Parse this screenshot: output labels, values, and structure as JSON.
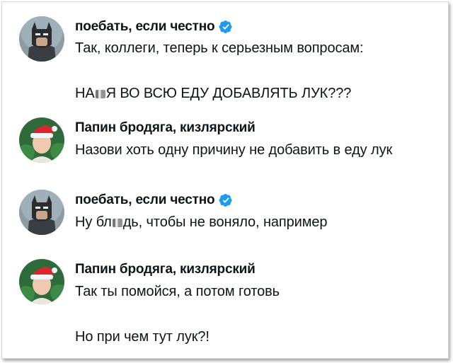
{
  "messages": [
    {
      "author": "поебать, если честно",
      "verified": true,
      "avatar": "batman-avatar",
      "lines": [
        "Так, коллеги, теперь к серьезным вопросам:"
      ],
      "line2_parts": [
        "НА",
        "Я ВО ВСЮ ЕДУ ДОБАВЛЯТЬ ЛУК???"
      ]
    },
    {
      "author": "Папин бродяга, кизлярский",
      "verified": false,
      "avatar": "santa-hat-avatar",
      "lines": [
        "Назови хоть одну причину не добавить в еду лук"
      ]
    },
    {
      "author": "поебать, если честно",
      "verified": true,
      "avatar": "batman-avatar",
      "line_parts": [
        "Ну бл",
        "дь, чтобы не воняло, например"
      ]
    },
    {
      "author": "Папин бродяга, кизлярский",
      "verified": false,
      "avatar": "santa-hat-avatar",
      "lines": [
        "Так ты помойся, а потом готовь",
        "Но при чем тут лук?!"
      ]
    }
  ],
  "colors": {
    "verified": "#1d9bf0",
    "text": "#0f1419"
  }
}
